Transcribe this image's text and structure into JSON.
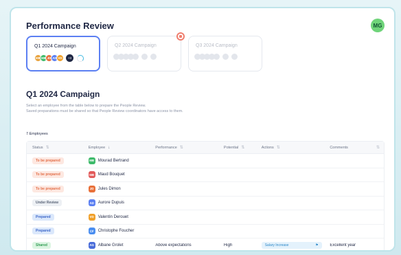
{
  "header": {
    "title": "Performance Review",
    "avatar": "MG",
    "avatar_color": "#6fd47a"
  },
  "campaigns": [
    {
      "title": "Q1 2024 Campaign",
      "active": true,
      "avatars": [
        {
          "initials": "MB",
          "color": "#e8a13a"
        },
        {
          "initials": "MB",
          "color": "#3dba6a"
        },
        {
          "initials": "JD",
          "color": "#e8703a"
        },
        {
          "initials": "AD",
          "color": "#5b7ff2"
        },
        {
          "initials": "VD",
          "color": "#f0a02a"
        }
      ],
      "more": "+3"
    },
    {
      "title": "Q2 2024 Campaign",
      "active": false
    },
    {
      "title": "Q3 2024 Campaign",
      "active": false
    }
  ],
  "section": {
    "title": "Q1 2024 Campaign",
    "desc1": "Select an employee from the table below to prepare the People Review.",
    "desc2": "Saved preparations must be shared so that People Review coordinators have access to them.",
    "employee_count": "7 Employees"
  },
  "table": {
    "columns": [
      "Status",
      "Employee",
      "Performance",
      "Potential",
      "Actions",
      "Comments"
    ],
    "rows": [
      {
        "status": "To be prepared",
        "status_type": "prep",
        "initials": "MB",
        "color": "#3dba6a",
        "name": "Mourad Bertrand",
        "performance": "",
        "potential": "",
        "action": "",
        "comment": ""
      },
      {
        "status": "To be prepared",
        "status_type": "prep",
        "initials": "MB",
        "color": "#e25a5a",
        "name": "Maud Bouquet",
        "performance": "",
        "potential": "",
        "action": "",
        "comment": ""
      },
      {
        "status": "To be prepared",
        "status_type": "prep",
        "initials": "JD",
        "color": "#e8703a",
        "name": "Jules Dimon",
        "performance": "",
        "potential": "",
        "action": "",
        "comment": ""
      },
      {
        "status": "Under Review",
        "status_type": "review",
        "initials": "AD",
        "color": "#5b7ff2",
        "name": "Aurore Dupuis",
        "performance": "",
        "potential": "",
        "action": "",
        "comment": ""
      },
      {
        "status": "Prepared",
        "status_type": "prepared",
        "initials": "VD",
        "color": "#f0a02a",
        "name": "Valentin Derouet",
        "performance": "",
        "potential": "",
        "action": "",
        "comment": ""
      },
      {
        "status": "Prepared",
        "status_type": "prepared",
        "initials": "CF",
        "color": "#4a8ef0",
        "name": "Christophe Foucher",
        "performance": "",
        "potential": "",
        "action": "",
        "comment": ""
      },
      {
        "status": "Shared",
        "status_type": "shared",
        "initials": "AG",
        "color": "#4a6cd9",
        "name": "Albane Grolet",
        "performance": "Above expectations",
        "potential": "High",
        "action": "Salary Increase",
        "comment": "Excellent year"
      }
    ]
  }
}
